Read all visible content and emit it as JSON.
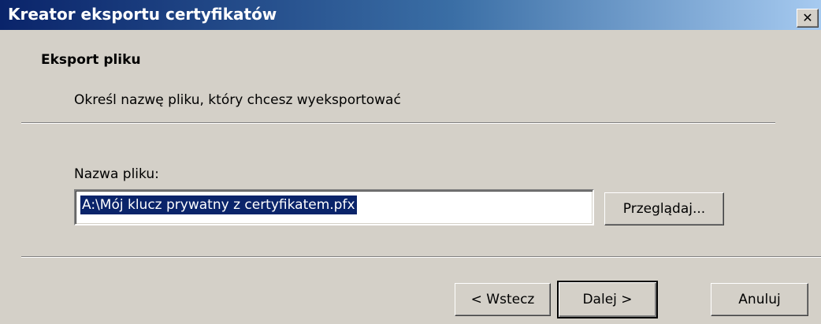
{
  "window": {
    "title": "Kreator eksportu certyfikatów",
    "close_glyph": "✕"
  },
  "header": {
    "section_title": "Eksport pliku",
    "section_subtitle": "Określ nazwę pliku, który chcesz wyeksportować"
  },
  "form": {
    "file_label": "Nazwa pliku:",
    "file_value": "A:\\Mój klucz prywatny z certyfikatem.pfx",
    "browse_label": "Przeglądaj..."
  },
  "footer": {
    "back_label": "< Wstecz",
    "next_label": "Dalej >",
    "cancel_label": "Anuluj"
  },
  "colors": {
    "titlebar_start": "#0a246a",
    "titlebar_end": "#a6caf0",
    "face": "#d4d0c8",
    "selection": "#0a246a"
  },
  "icons": {
    "close": "close-icon"
  }
}
